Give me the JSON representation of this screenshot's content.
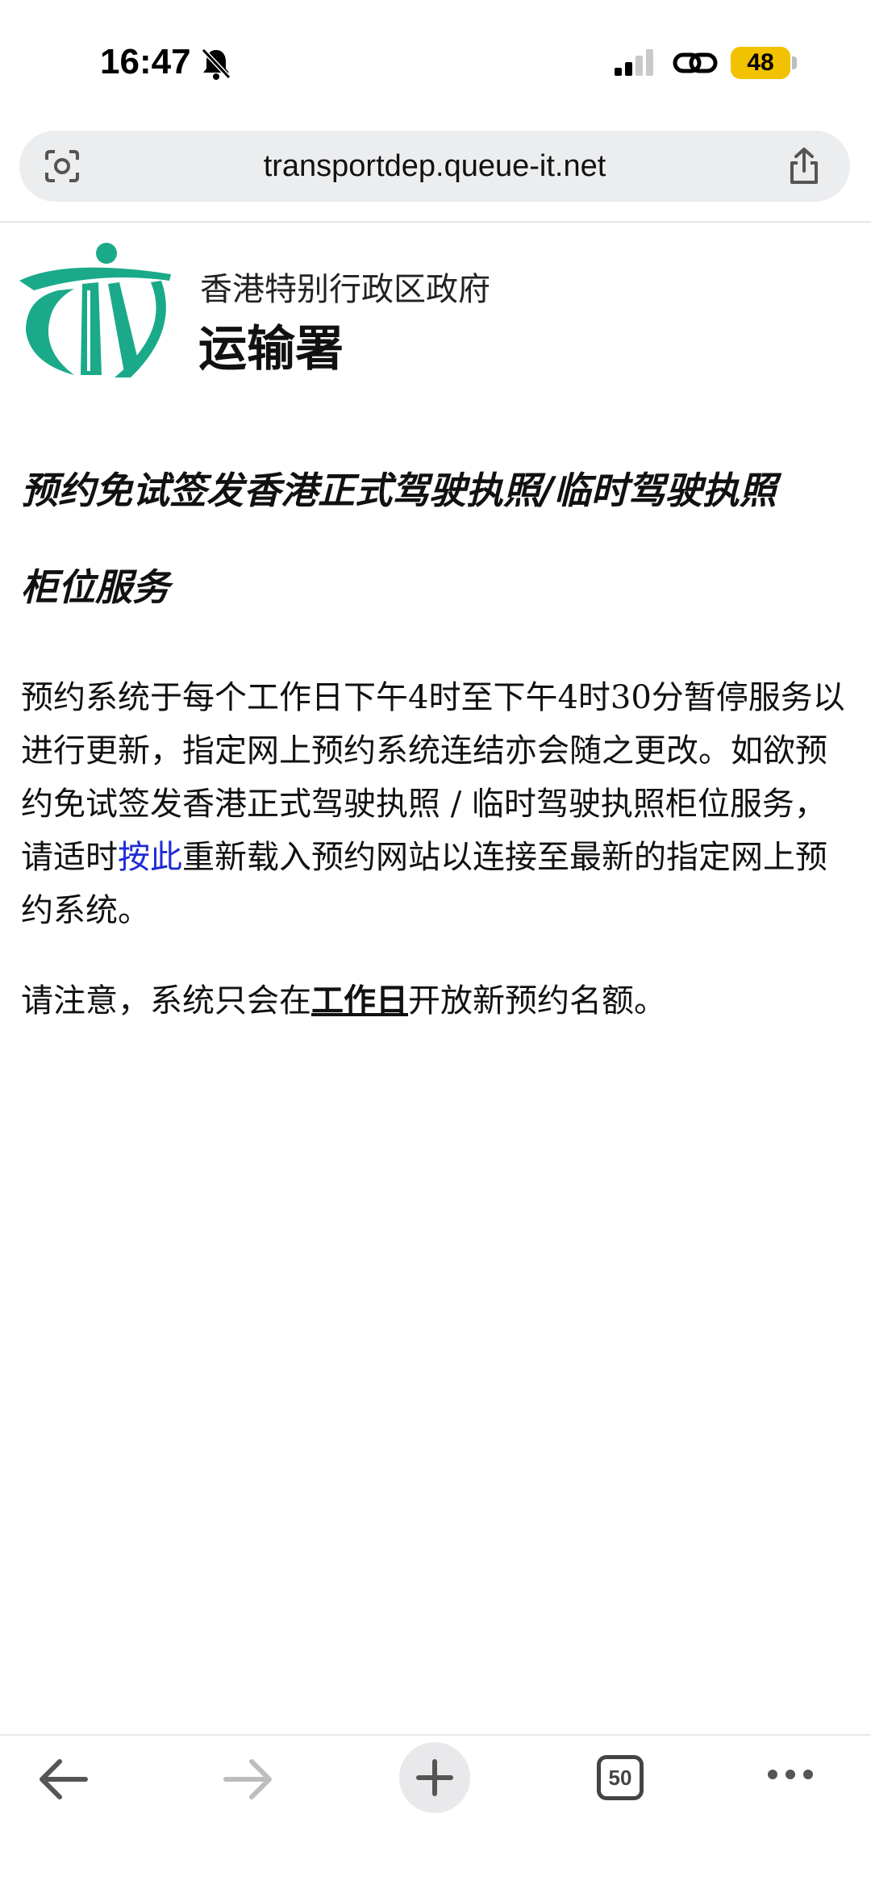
{
  "status_bar": {
    "time": "16:47",
    "battery": "48",
    "icons": [
      "bell-slash-icon",
      "signal-icon",
      "link-icon"
    ]
  },
  "browser": {
    "url": "transportdep.queue-it.net",
    "tab_count": "50",
    "toolbar_icons": [
      "back-arrow-icon",
      "forward-arrow-icon",
      "plus-icon",
      "tabs-icon",
      "more-icon"
    ]
  },
  "header": {
    "gov_name": "香港特别行政区政府",
    "dept_name": "运输署"
  },
  "content": {
    "title_line1": "预约免试签发香港正式驾驶执照/临时驾驶执照",
    "title_line2": "柜位服务",
    "p1_before_link": "预约系统于每个工作日下午4时至下午4时30分暂停服务以进行更新，指定网上预约系统连结亦会随之更改。如欲预约免试签发香港正式驾驶执照 / 临时驾驶执照柜位服务，请适时",
    "p1_link": "按此",
    "p1_after_link": "重新载入预约网站以连接至最新的指定网上预约系统。",
    "p2_before": "请注意，系统只会在",
    "p2_bold": "工作日",
    "p2_after": "开放新预约名额。"
  },
  "colors": {
    "logo_green": "#1aaa8a",
    "link_blue": "#1f2bd6",
    "battery_yellow": "#f2c200"
  }
}
